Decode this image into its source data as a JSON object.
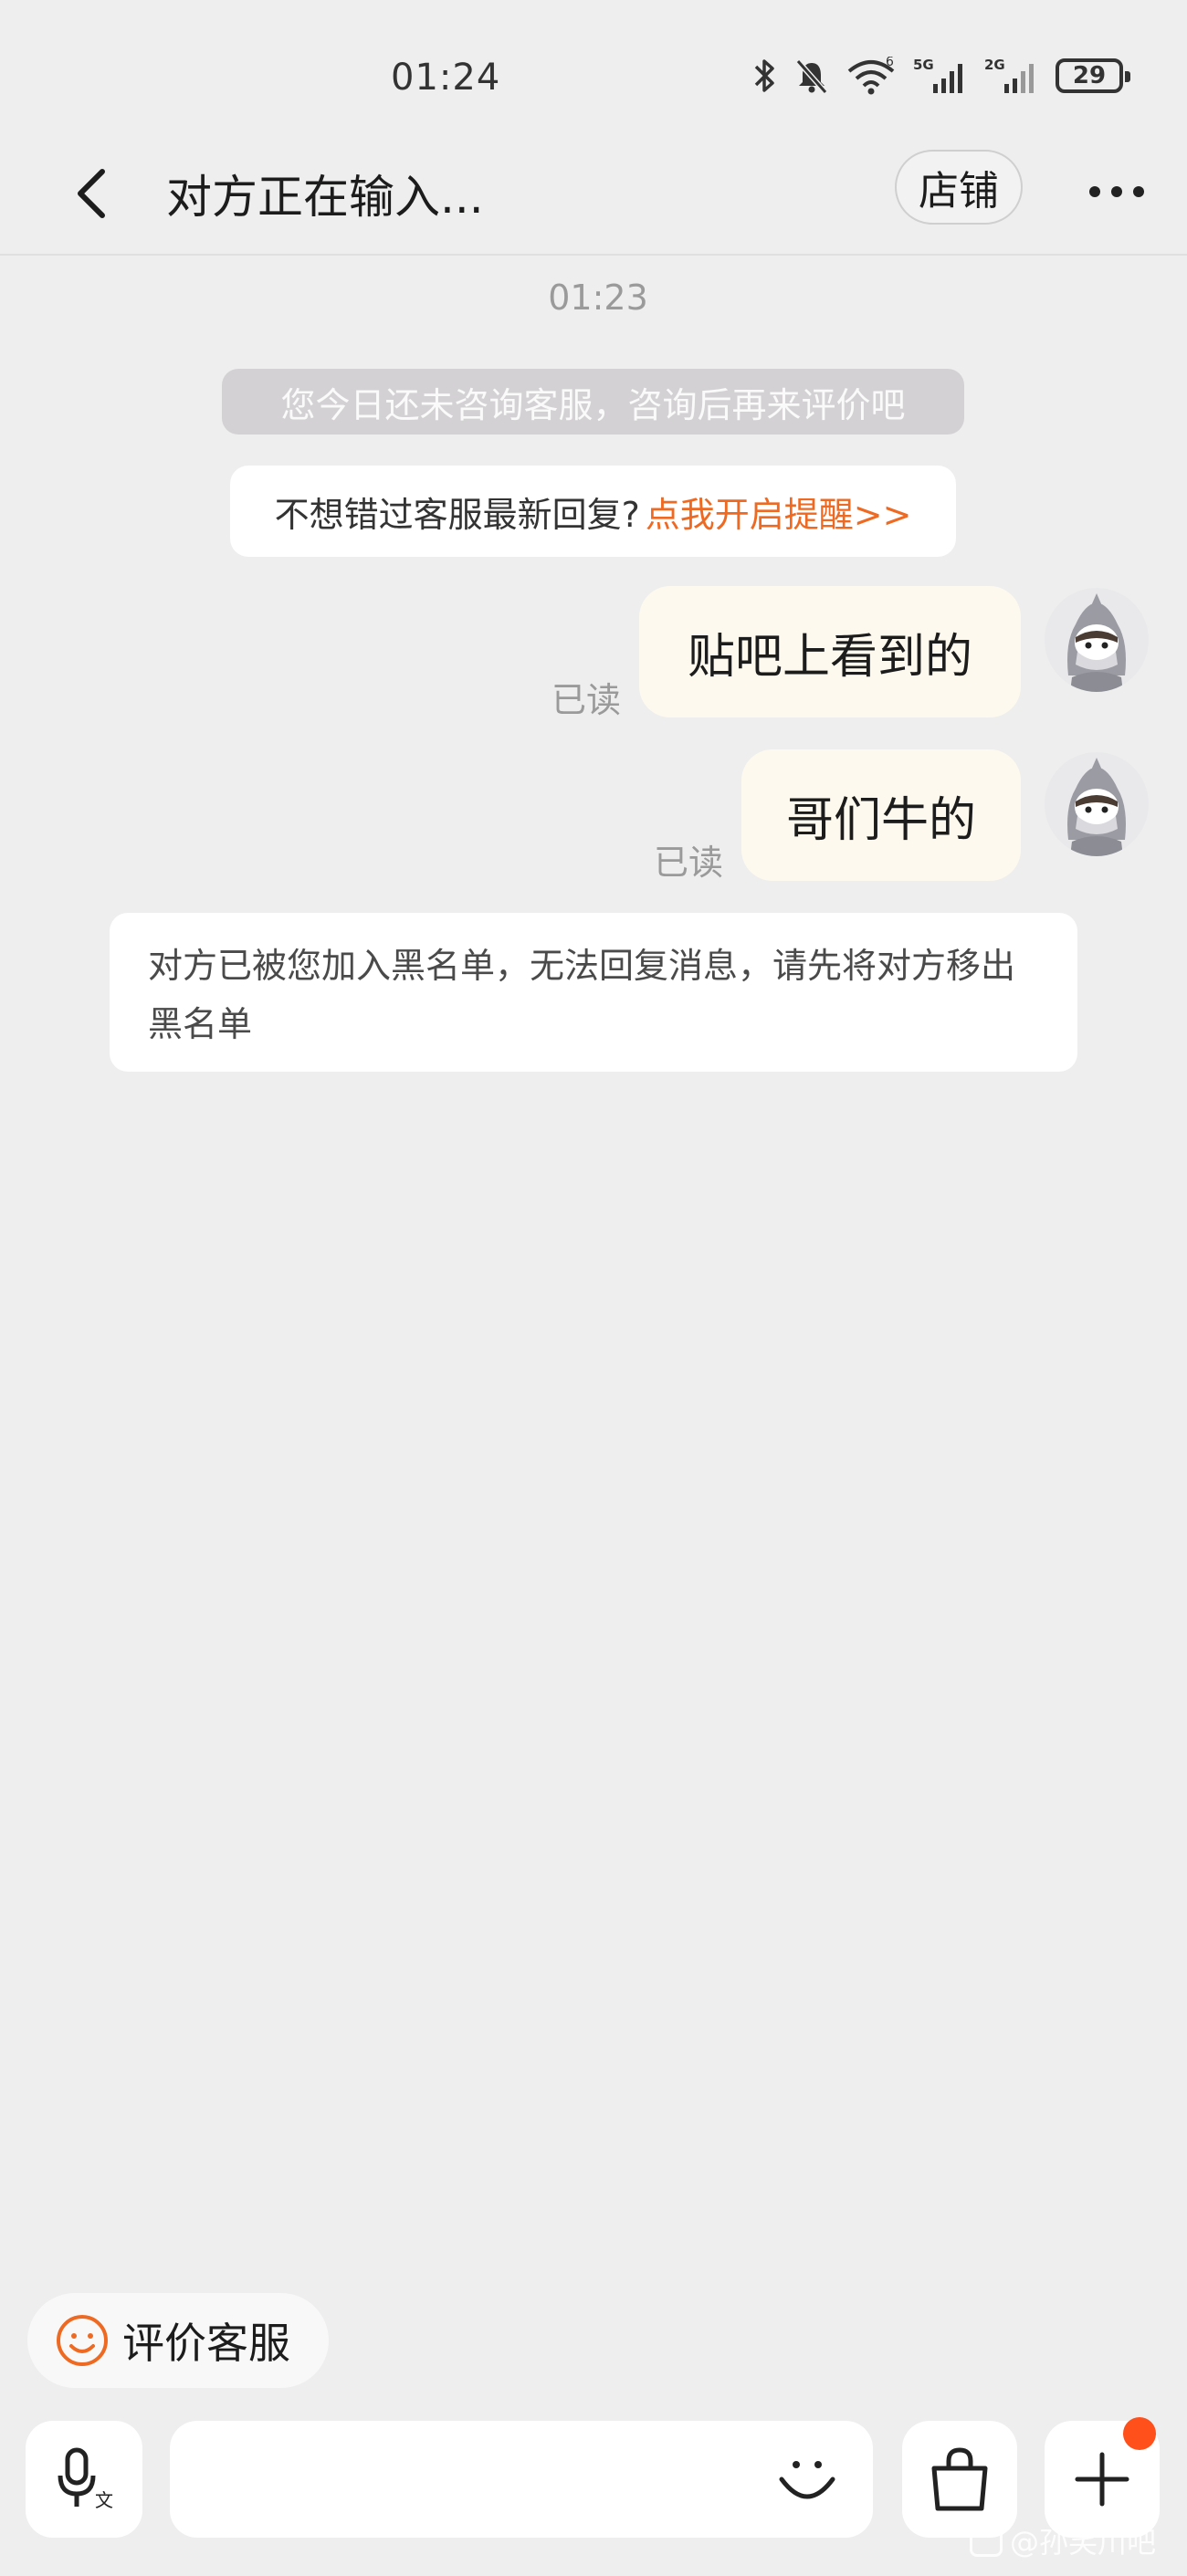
{
  "status_bar": {
    "time": "01:24",
    "battery": "29",
    "signal_labels": [
      "6",
      "5G",
      "2G"
    ]
  },
  "header": {
    "title": "对方正在输入...",
    "shop_label": "店铺"
  },
  "chat": {
    "timestamp": "01:23",
    "tip_gray": "您今日还未咨询客服，咨询后再来评价吧",
    "tip_white_text": "不想错过客服最新回复?",
    "tip_white_link": "点我开启提醒>>",
    "messages": [
      {
        "text": "贴吧上看到的",
        "status": "已读"
      },
      {
        "text": "哥们牛的",
        "status": "已读"
      }
    ],
    "system_notice": "对方已被您加入黑名单，无法回复消息，请先将对方移出黑名单"
  },
  "bottom": {
    "rate_label": "评价客服",
    "voice_icon_caption": "文"
  },
  "watermark": "@孙笑川吧",
  "colors": {
    "accent": "#ee6a22",
    "bubble": "#fdf9ee",
    "background": "#edeeed",
    "red_dot": "#ff4f1b"
  }
}
